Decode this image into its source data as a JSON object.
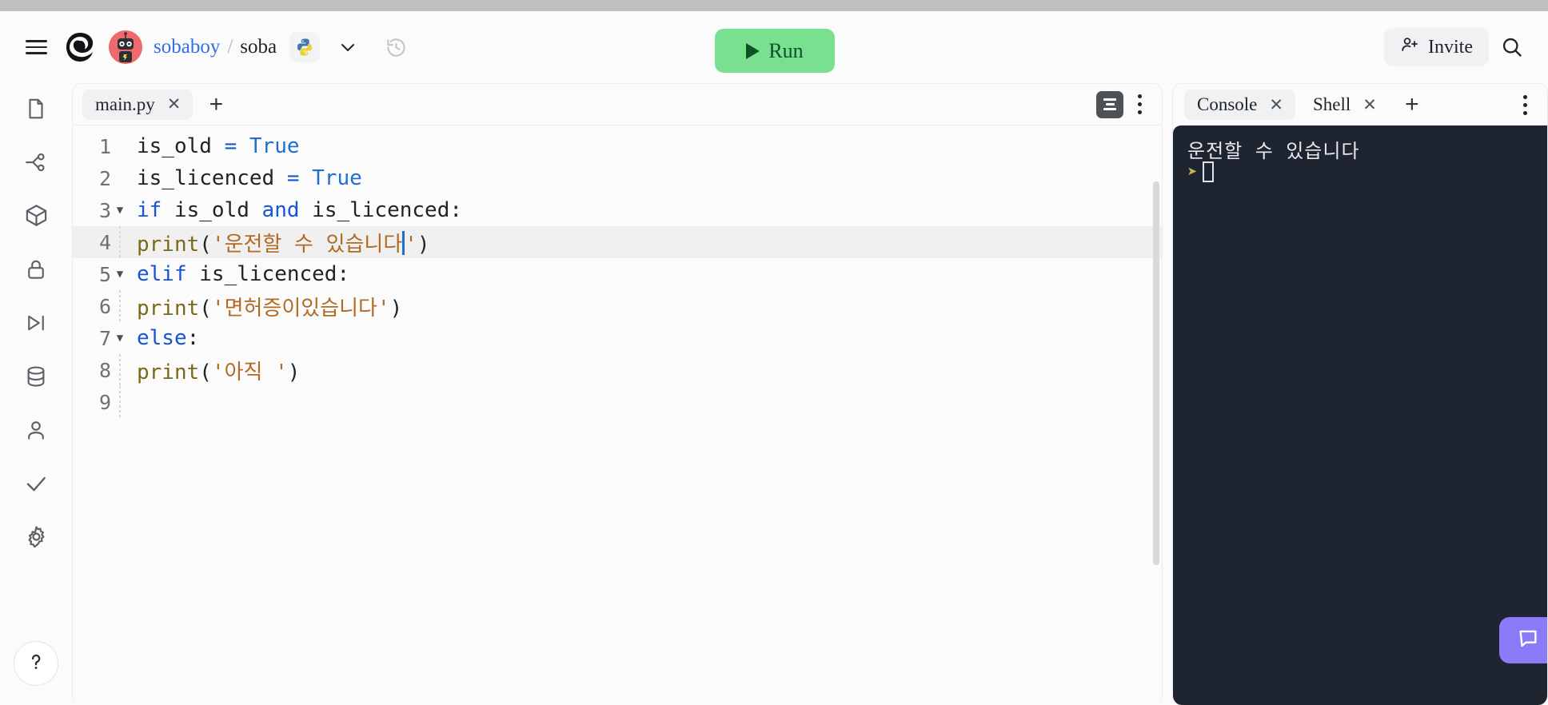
{
  "header": {
    "menu_icon": "hamburger-menu-icon",
    "logo_icon": "replit-logo-icon",
    "avatar_icon": "user-avatar-robot-icon",
    "breadcrumb": {
      "owner": "sobaboy",
      "separator": "/",
      "repl_name": "soba"
    },
    "language_badge_icon": "python-logo-icon",
    "chevron_icon": "chevron-down-icon",
    "history_icon": "history-clock-icon",
    "run_label": "Run",
    "run_icon": "play-triangle-icon",
    "run_color": "#78e08f",
    "invite_label": "Invite",
    "invite_icon": "person-add-icon",
    "search_icon": "search-icon"
  },
  "rail": {
    "items": [
      {
        "name": "files",
        "icon": "file-icon"
      },
      {
        "name": "git",
        "icon": "git-branch-icon"
      },
      {
        "name": "packages",
        "icon": "package-cube-icon"
      },
      {
        "name": "secrets",
        "icon": "lock-icon"
      },
      {
        "name": "debugger",
        "icon": "step-play-icon"
      },
      {
        "name": "database",
        "icon": "database-icon"
      },
      {
        "name": "account",
        "icon": "person-icon"
      },
      {
        "name": "checks",
        "icon": "checkmark-icon"
      },
      {
        "name": "settings",
        "icon": "gear-icon"
      }
    ],
    "help_icon": "question-mark-icon"
  },
  "editor": {
    "tabs": [
      {
        "label": "main.py",
        "active": true,
        "close_icon": "close-x-icon"
      }
    ],
    "add_tab_icon": "plus-icon",
    "format_icon": "format-document-icon",
    "kebab_icon": "more-options-vertical-icon",
    "lines": [
      {
        "n": "1",
        "fold": "",
        "indent": 0,
        "tokens": [
          {
            "t": "is_old ",
            "c": "plain"
          },
          {
            "t": "=",
            "c": "op"
          },
          {
            "t": " ",
            "c": "plain"
          },
          {
            "t": "True",
            "c": "bool"
          }
        ]
      },
      {
        "n": "2",
        "fold": "",
        "indent": 0,
        "tokens": [
          {
            "t": "is_licenced ",
            "c": "plain"
          },
          {
            "t": "=",
            "c": "op"
          },
          {
            "t": " ",
            "c": "plain"
          },
          {
            "t": "True",
            "c": "bool"
          }
        ]
      },
      {
        "n": "3",
        "fold": "▼",
        "indent": 0,
        "tokens": [
          {
            "t": "if",
            "c": "kw"
          },
          {
            "t": " is_old ",
            "c": "plain"
          },
          {
            "t": "and",
            "c": "kw"
          },
          {
            "t": " is_licenced:",
            "c": "plain"
          }
        ]
      },
      {
        "n": "4",
        "fold": "",
        "indent": 1,
        "highlight": true,
        "caret_after": 4,
        "tokens": [
          {
            "t": "print",
            "c": "fn"
          },
          {
            "t": "(",
            "c": "punct"
          },
          {
            "t": "'",
            "c": "str"
          },
          {
            "t": "운전할 수 있습니다",
            "c": "str"
          },
          {
            "t": "'",
            "c": "str"
          },
          {
            "t": ")",
            "c": "punct"
          }
        ]
      },
      {
        "n": "5",
        "fold": "▼",
        "indent": 0,
        "tokens": [
          {
            "t": "elif",
            "c": "kw"
          },
          {
            "t": " is_licenced:",
            "c": "plain"
          }
        ]
      },
      {
        "n": "6",
        "fold": "",
        "indent": 1,
        "tokens": [
          {
            "t": "print",
            "c": "fn"
          },
          {
            "t": "(",
            "c": "punct"
          },
          {
            "t": "'면허증이있습니다'",
            "c": "str"
          },
          {
            "t": ")",
            "c": "punct"
          }
        ]
      },
      {
        "n": "7",
        "fold": "▼",
        "indent": 0,
        "tokens": [
          {
            "t": "else",
            "c": "kw"
          },
          {
            "t": ":",
            "c": "plain"
          }
        ]
      },
      {
        "n": "8",
        "fold": "",
        "indent": 1,
        "tokens": [
          {
            "t": "print",
            "c": "fn"
          },
          {
            "t": "(",
            "c": "punct"
          },
          {
            "t": "'아직 '",
            "c": "str"
          },
          {
            "t": ")",
            "c": "punct"
          }
        ]
      },
      {
        "n": "9",
        "fold": "",
        "indent": 1,
        "tokens": []
      }
    ]
  },
  "console": {
    "tabs": [
      {
        "label": "Console",
        "active": true,
        "close_icon": "close-x-icon"
      },
      {
        "label": "Shell",
        "active": false,
        "close_icon": "close-x-icon"
      }
    ],
    "add_tab_icon": "plus-icon",
    "kebab_icon": "more-options-vertical-icon",
    "output_lines": [
      "운전할 수 있습니다"
    ],
    "prompt_symbol": "➤",
    "background": "#1e2430",
    "chat_fab_icon": "chat-bubble-icon",
    "chat_fab_color": "#8a7bf8"
  }
}
